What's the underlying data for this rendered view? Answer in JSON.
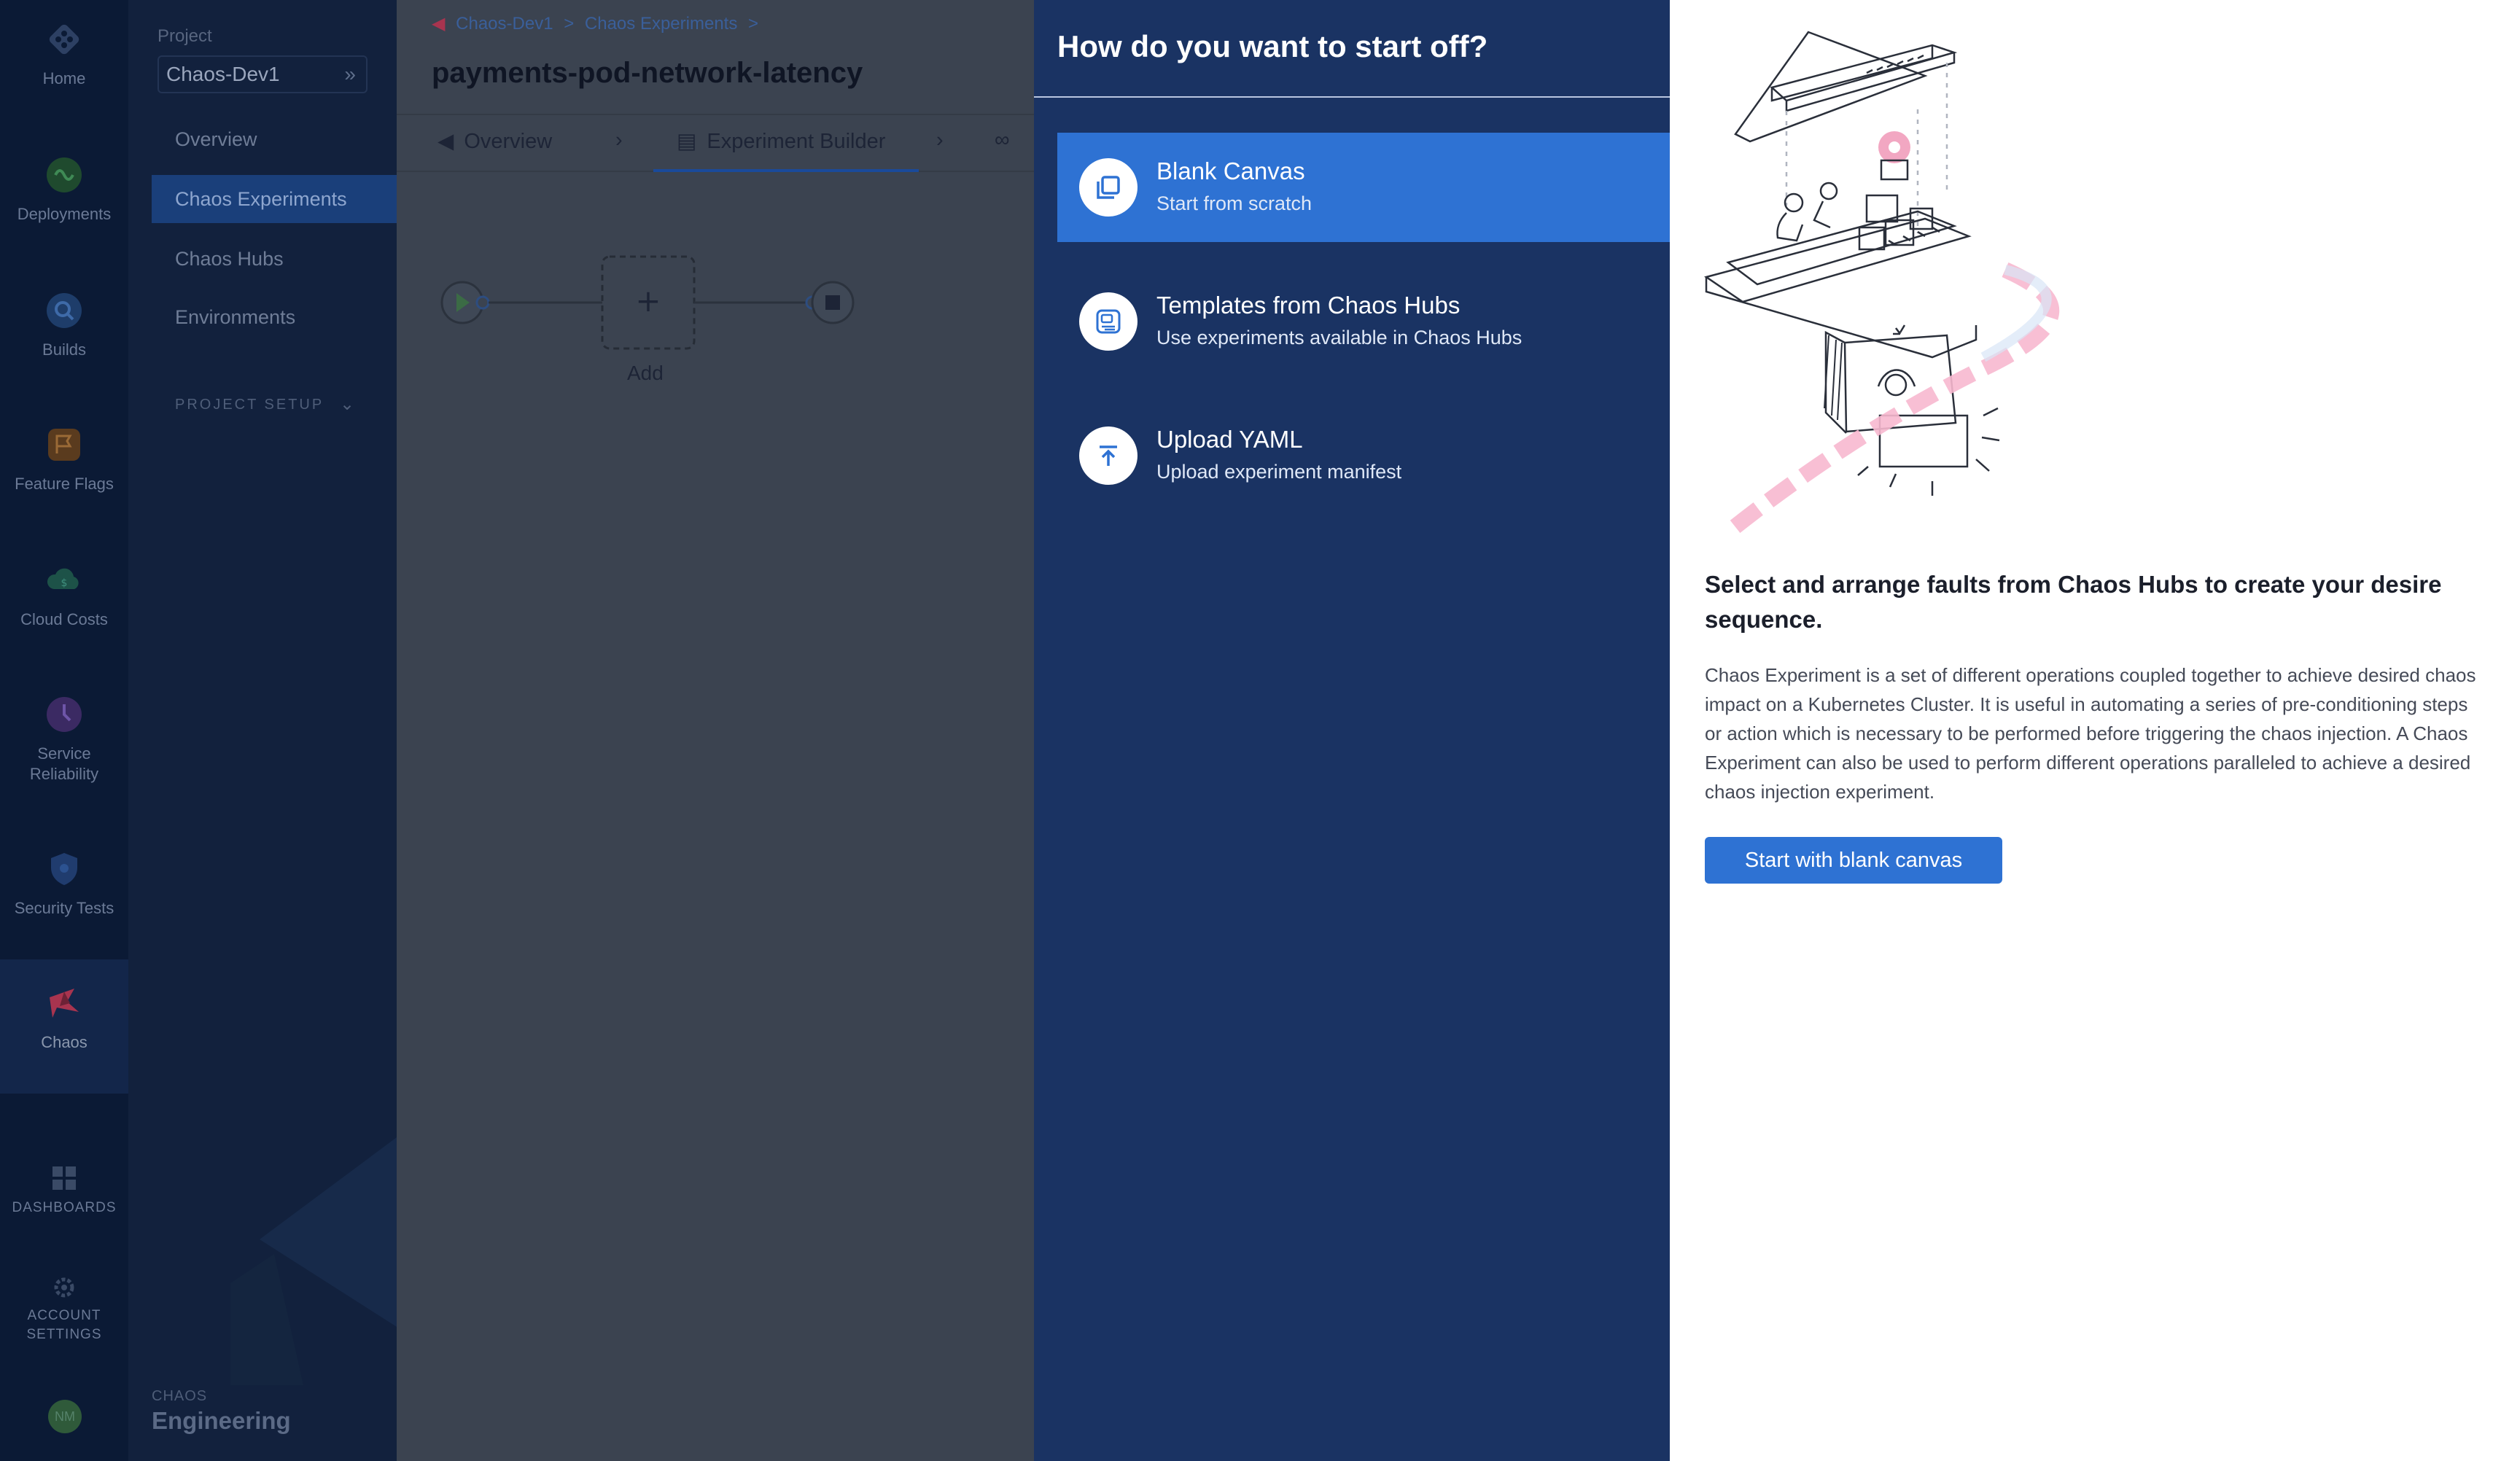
{
  "rail": {
    "items": [
      {
        "label": "Home",
        "icon": "home-icon"
      },
      {
        "label": "Deployments",
        "icon": "deployments-icon"
      },
      {
        "label": "Builds",
        "icon": "builds-icon"
      },
      {
        "label": "Feature Flags",
        "icon": "feature-flags-icon"
      },
      {
        "label": "Cloud Costs",
        "icon": "cloud-costs-icon"
      },
      {
        "label": "Service\nReliability",
        "icon": "service-reliability-icon"
      },
      {
        "label": "Security Tests",
        "icon": "security-tests-icon"
      },
      {
        "label": "Chaos",
        "icon": "chaos-icon"
      },
      {
        "label": "DASHBOARDS",
        "icon": "dashboards-icon"
      },
      {
        "label": "ACCOUNT\nSETTINGS",
        "icon": "gear-icon"
      }
    ],
    "avatar_initials": "NM"
  },
  "project_nav": {
    "project_label": "Project",
    "project_name": "Chaos-Dev1",
    "items": [
      {
        "label": "Overview"
      },
      {
        "label": "Chaos Experiments"
      },
      {
        "label": "Chaos Hubs"
      },
      {
        "label": "Environments"
      }
    ],
    "project_setup": "PROJECT SETUP",
    "module_small": "CHAOS",
    "module_big": "Engineering"
  },
  "main": {
    "breadcrumb": [
      "Chaos-Dev1",
      "Chaos Experiments"
    ],
    "title": "payments-pod-network-latency",
    "tabs": [
      {
        "label": "Overview"
      },
      {
        "label": "Experiment Builder"
      }
    ],
    "add_label": "Add"
  },
  "drawer": {
    "title": "How do you want to start off?",
    "options": [
      {
        "title": "Blank Canvas",
        "subtitle": "Start from scratch",
        "icon": "blank-canvas-icon"
      },
      {
        "title": "Templates from Chaos Hubs",
        "subtitle": "Use experiments available in Chaos Hubs",
        "icon": "templates-icon"
      },
      {
        "title": "Upload YAML",
        "subtitle": "Upload experiment manifest",
        "icon": "upload-icon"
      }
    ],
    "info": {
      "heading": "Select and arrange faults from Chaos Hubs to create your desire sequence.",
      "body": "Chaos Experiment is a set of different operations coupled together to achieve desired chaos impact on a Kubernetes Cluster. It is useful in automating a series of pre-conditioning steps or action which is necessary to be performed before triggering the chaos injection. A Chaos Experiment can also be used to perform different operations paralleled to achieve a desired chaos injection experiment.",
      "cta": "Start with blank canvas"
    }
  },
  "colors": {
    "accent": "#2e72d3",
    "drawer_bg": "#1a3363",
    "rail_bg": "#0b1a35",
    "chaos_brand": "#e0446a"
  }
}
